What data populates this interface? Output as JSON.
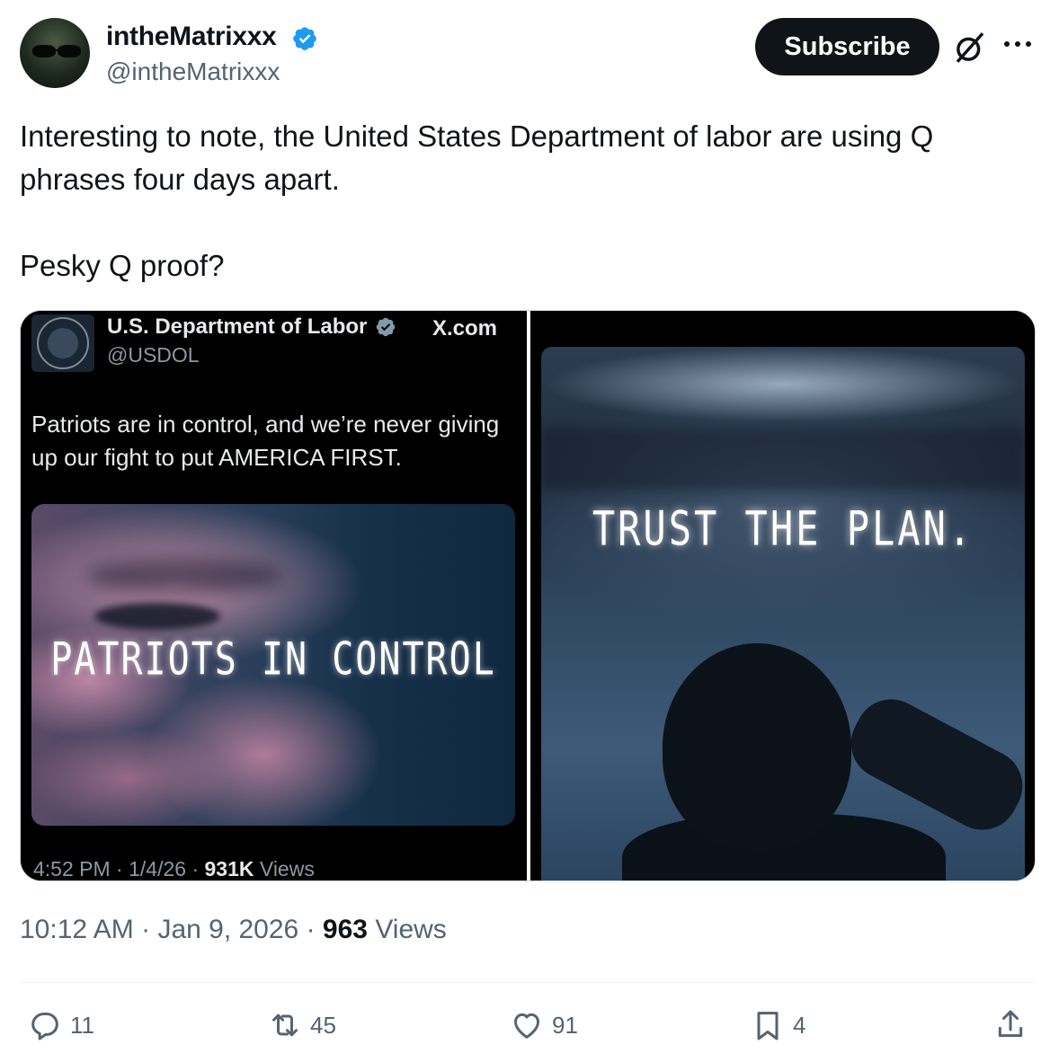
{
  "author": {
    "display_name": "intheMatrixxx",
    "handle": "@intheMatrixxx"
  },
  "header": {
    "subscribe_label": "Subscribe",
    "colors": {
      "verified": "#1d9bf0",
      "subscribe_bg": "#0f1419"
    }
  },
  "tweet": {
    "paragraphs": [
      "Interesting to note, the United States Department of labor are using Q phrases four days apart.",
      "Pesky Q proof?"
    ]
  },
  "media": {
    "left": {
      "account_name": "U.S. Department of Labor",
      "account_handle": "@USDOL",
      "source": "X.com",
      "text": "Patriots are in control, and we’re never giving up our fight to put AMERICA FIRST.",
      "image_caption": "PATRIOTS IN CONTROL",
      "time": "4:52 PM",
      "date": "1/4/26",
      "views_count": "931K",
      "views_label": "Views"
    },
    "right": {
      "image_caption": "TRUST THE PLAN."
    }
  },
  "meta": {
    "time": "10:12 AM",
    "date": "Jan 9, 2026",
    "views_count": "963",
    "views_label": "Views"
  },
  "actions": {
    "replies": "11",
    "reposts": "45",
    "likes": "91",
    "bookmarks": "4"
  },
  "icons": [
    "verified-badge-icon",
    "grok-icon",
    "more-icon",
    "reply-icon",
    "repost-icon",
    "like-icon",
    "bookmark-icon",
    "share-icon"
  ]
}
